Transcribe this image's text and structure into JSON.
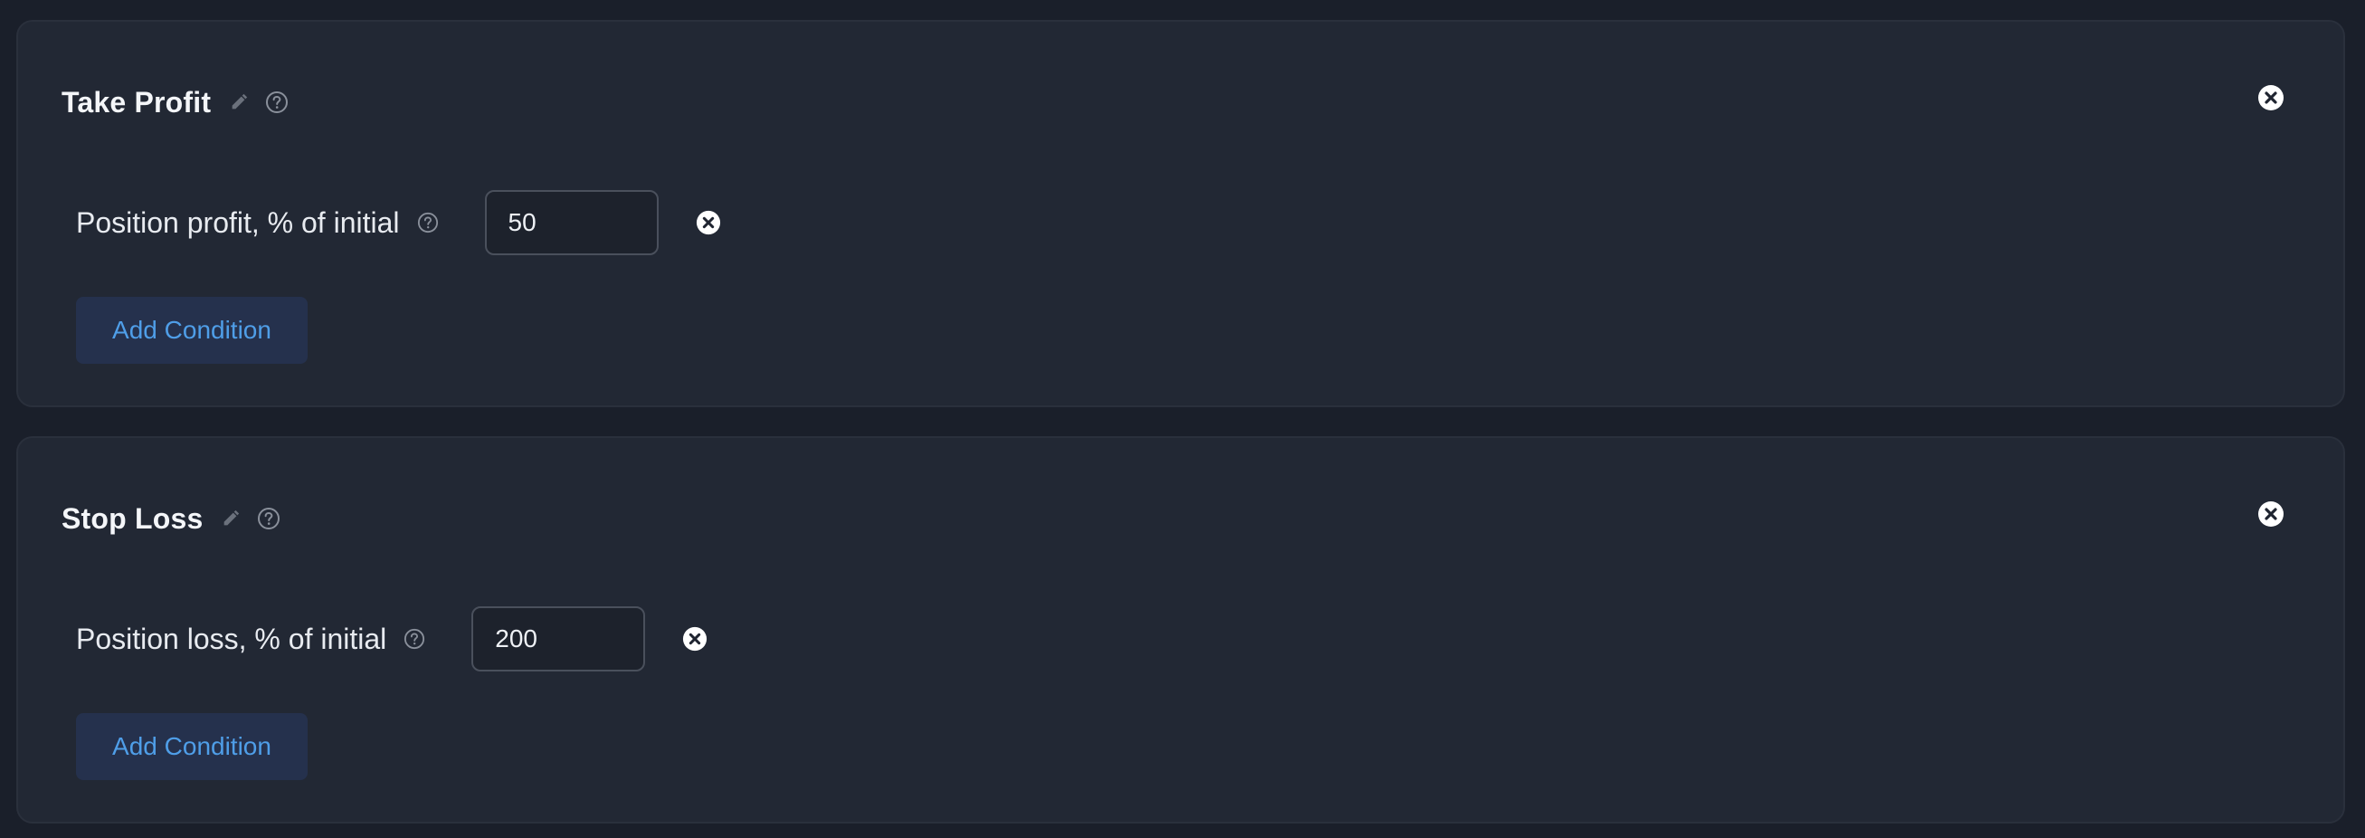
{
  "colors": {
    "page_bg": "#1a1f2a",
    "panel_bg": "#222834",
    "title_text": "#f4f6f9",
    "icon_muted": "#8a909b",
    "button_bg": "#25314d",
    "button_text": "#4f9ee8",
    "close_icon": "#ffffff"
  },
  "take_profit": {
    "title": "Take Profit",
    "icons": [
      "pencil-icon",
      "help-circle-icon",
      "close-circle-icon"
    ],
    "condition": {
      "label": "Position profit, % of initial",
      "value": "50"
    },
    "add_condition_label": "Add Condition"
  },
  "stop_loss": {
    "title": "Stop Loss",
    "icons": [
      "pencil-icon",
      "help-circle-icon",
      "close-circle-icon"
    ],
    "condition": {
      "label": "Position loss, % of initial",
      "value": "200"
    },
    "add_condition_label": "Add Condition"
  }
}
